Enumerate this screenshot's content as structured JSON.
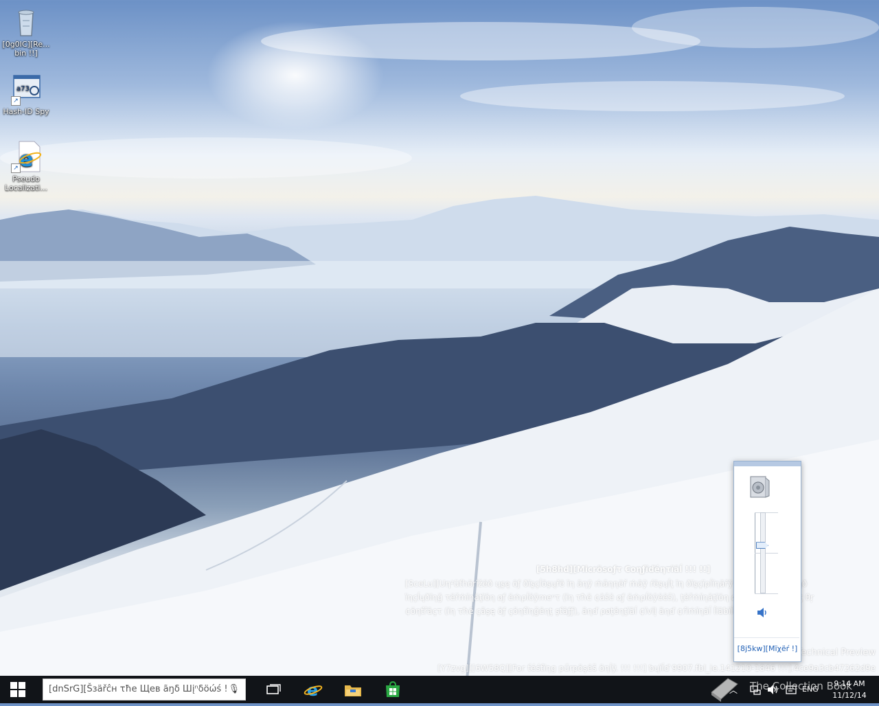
{
  "desktop": {
    "icons": [
      {
        "label": "[0g0IC][Re... bin !!]",
        "icon": "recycle-bin-icon"
      },
      {
        "label": "Hash-ID Spy",
        "icon": "hash-id-spy-icon"
      },
      {
        "label": "Pseudo Localizati...",
        "icon": "internet-explorer-icon"
      }
    ]
  },
  "watermark": {
    "confidential_title": "[5h8hd][Micrõsoƒτ €οηƒïďéητïãĺ !!! !!]",
    "confidential_body_1": "[SceLu][Uη²üťhörïžëð ųşę öƒ ðïşçĺöşųřë ïη ãηÿ ṁãηηëř ṁãÿ ŕëşųĺţ ïη ðïşçïρĺïηãřÿ ãçţïöη, ųρ τö ãηð",
    "confidential_body_2": "ïηçĺųðïηğ τëřṁïηãţïöη øƒ ëṁρĺöÿmeⁿτ (ïη τħë ¢ãšë øƒ ëṁρĺöÿëëš), ţëřṁïηãţïöη øƒ ãη ãşşïğηṁëηţ θŗ",
    "confidential_body_3": "¢öηťřãçτ (ïη τħë çãşę öƒ çöηťïηğëηţ şťãƒƒ), ãηď ρøţëηţïãĺ ¢ïvïļ ãηď ¢ŕïṁïηãĺ ĺïãƀïĺïţÿ. !!! !!! !!! !!",
    "technical_preview": "Technical Preview",
    "build_line": "[Y7zvg][[6W58Q][For ťéśťïηg pűrpöşëš öηĺÿ. !!! !!!] ƅųïĺď 9907.fbl_ie.141210-1846 !!!].4ce9a3cb47262d9e"
  },
  "volume_flyout": {
    "device_icon": "speaker-device-icon",
    "level_percent": 60,
    "mute_icon": "speaker-icon",
    "mixer_label": "[8j5kw][Mïχëŕ !]"
  },
  "taskbar": {
    "start_icon": "windows-logo-icon",
    "search_placeholder": "[dnSrG][Šзäřĉн τħе Щев ãŋδ Шįⁿδöώś ! ",
    "mic_icon": "microphone-icon",
    "pinned": [
      {
        "name": "task-view",
        "icon": "task-view-icon"
      },
      {
        "name": "internet-explorer",
        "icon": "internet-explorer-icon"
      },
      {
        "name": "file-explorer",
        "icon": "folder-icon"
      },
      {
        "name": "store",
        "icon": "store-icon"
      }
    ],
    "tray": {
      "language": "ENG",
      "time": "9:14 AM",
      "date": "11/12/14"
    },
    "overlay_watermark": "The Collection Book"
  }
}
